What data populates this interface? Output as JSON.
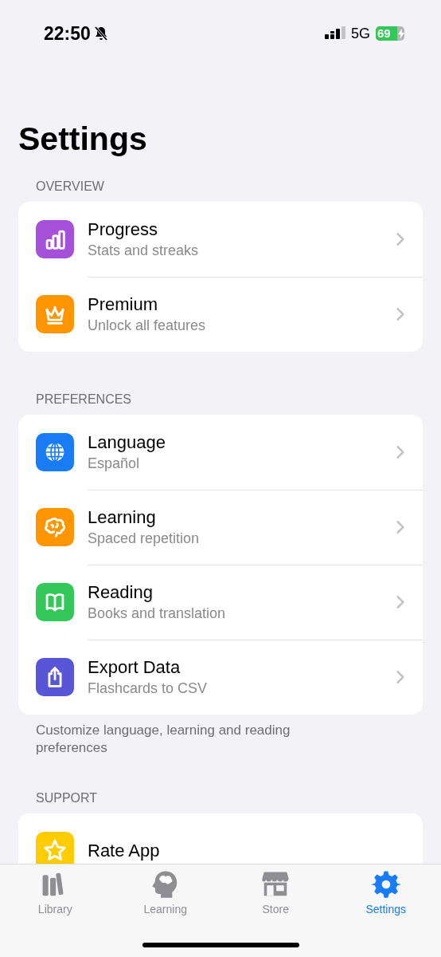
{
  "status_bar": {
    "time": "22:50",
    "network": "5G",
    "battery": "69"
  },
  "title": "Settings",
  "sections": [
    {
      "header": "OVERVIEW",
      "rows": [
        {
          "title": "Progress",
          "subtitle": "Stats and streaks",
          "color": "#a550d8"
        },
        {
          "title": "Premium",
          "subtitle": "Unlock all features",
          "color": "#ff9500"
        }
      ]
    },
    {
      "header": "PREFERENCES",
      "rows": [
        {
          "title": "Language",
          "subtitle": "Español",
          "color": "#1a7cf5"
        },
        {
          "title": "Learning",
          "subtitle": "Spaced repetition",
          "color": "#ff9500"
        },
        {
          "title": "Reading",
          "subtitle": "Books and translation",
          "color": "#34c759"
        },
        {
          "title": "Export Data",
          "subtitle": "Flashcards to CSV",
          "color": "#5856d6"
        }
      ],
      "footer": "Customize language, learning and reading preferences"
    },
    {
      "header": "SUPPORT",
      "rows": [
        {
          "title": "Rate App",
          "color": "#ffcc00"
        }
      ]
    }
  ],
  "tabs": [
    {
      "label": "Library",
      "selected": false
    },
    {
      "label": "Learning",
      "selected": false
    },
    {
      "label": "Store",
      "selected": false
    },
    {
      "label": "Settings",
      "selected": true
    }
  ]
}
